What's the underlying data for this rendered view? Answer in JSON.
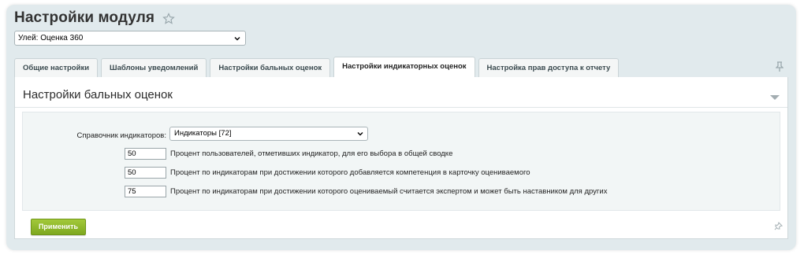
{
  "page": {
    "title": "Настройки модуля",
    "star_icon": "star-icon"
  },
  "module_select": {
    "value": "Улей: Оценка 360",
    "icon": "chevron-down-icon"
  },
  "tabs": [
    {
      "label": "Общие настройки",
      "active": false
    },
    {
      "label": "Шаблоны уведомлений",
      "active": false
    },
    {
      "label": "Настройки бальных оценок",
      "active": false
    },
    {
      "label": "Настройки индикаторных оценок",
      "active": true
    },
    {
      "label": "Настройка прав доступа к отчету",
      "active": false
    }
  ],
  "panel": {
    "title": "Настройки бальных оценок",
    "directory": {
      "label": "Справочник индикаторов:",
      "value": "Индикаторы [72]"
    },
    "rows": [
      {
        "value": "50",
        "text": "Процент пользователей, отметивших индикатор, для его выбора в общей сводке"
      },
      {
        "value": "50",
        "text": "Процент по индикаторам при достижении которого добавляется компетенция в карточку оцениваемого"
      },
      {
        "value": "75",
        "text": "Процент по индикаторам при достижении которого оцениваемый считается экспертом и может быть наставником для других"
      }
    ],
    "apply_label": "Применить"
  },
  "colors": {
    "accent": "#8cb52a",
    "frame": "#e1eaed"
  }
}
